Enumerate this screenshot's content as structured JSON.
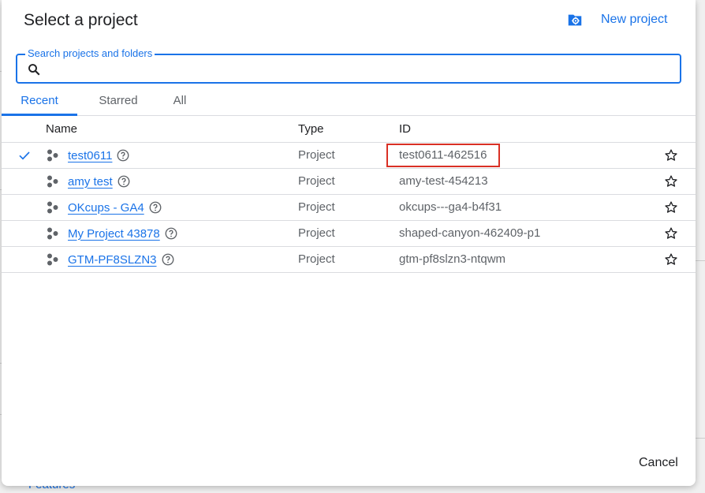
{
  "dialog": {
    "title": "Select a project",
    "new_project_label": "New project"
  },
  "search": {
    "label": "Search projects and folders",
    "value": "",
    "placeholder": ""
  },
  "tabs": [
    {
      "label": "Recent",
      "active": true
    },
    {
      "label": "Starred",
      "active": false
    },
    {
      "label": "All",
      "active": false
    }
  ],
  "table": {
    "headers": {
      "name": "Name",
      "type": "Type",
      "id": "ID"
    },
    "rows": [
      {
        "name": "test0611",
        "type": "Project",
        "id": "test0611-462516",
        "selected": true
      },
      {
        "name": "amy test",
        "type": "Project",
        "id": "amy-test-454213",
        "selected": false
      },
      {
        "name": "OKcups - GA4",
        "type": "Project",
        "id": "okcups---ga4-b4f31",
        "selected": false
      },
      {
        "name": "My Project 43878",
        "type": "Project",
        "id": "shaped-canyon-462409-p1",
        "selected": false
      },
      {
        "name": "GTM-PF8SLZN3",
        "type": "Project",
        "id": "gtm-pf8slzn3-ntqwm",
        "selected": false
      }
    ]
  },
  "footer": {
    "cancel_label": "Cancel"
  },
  "background": {
    "features_label": "Features"
  },
  "colors": {
    "accent": "#1a73e8",
    "highlight": "#d93025",
    "text_primary": "#202124",
    "text_secondary": "#5f6368"
  },
  "icons": {
    "new_project": "folder-gear-icon",
    "search": "search-icon",
    "selected": "check-icon",
    "project": "project-hexagon-icon",
    "help": "help-circle-icon",
    "star": "star-outline-icon"
  }
}
